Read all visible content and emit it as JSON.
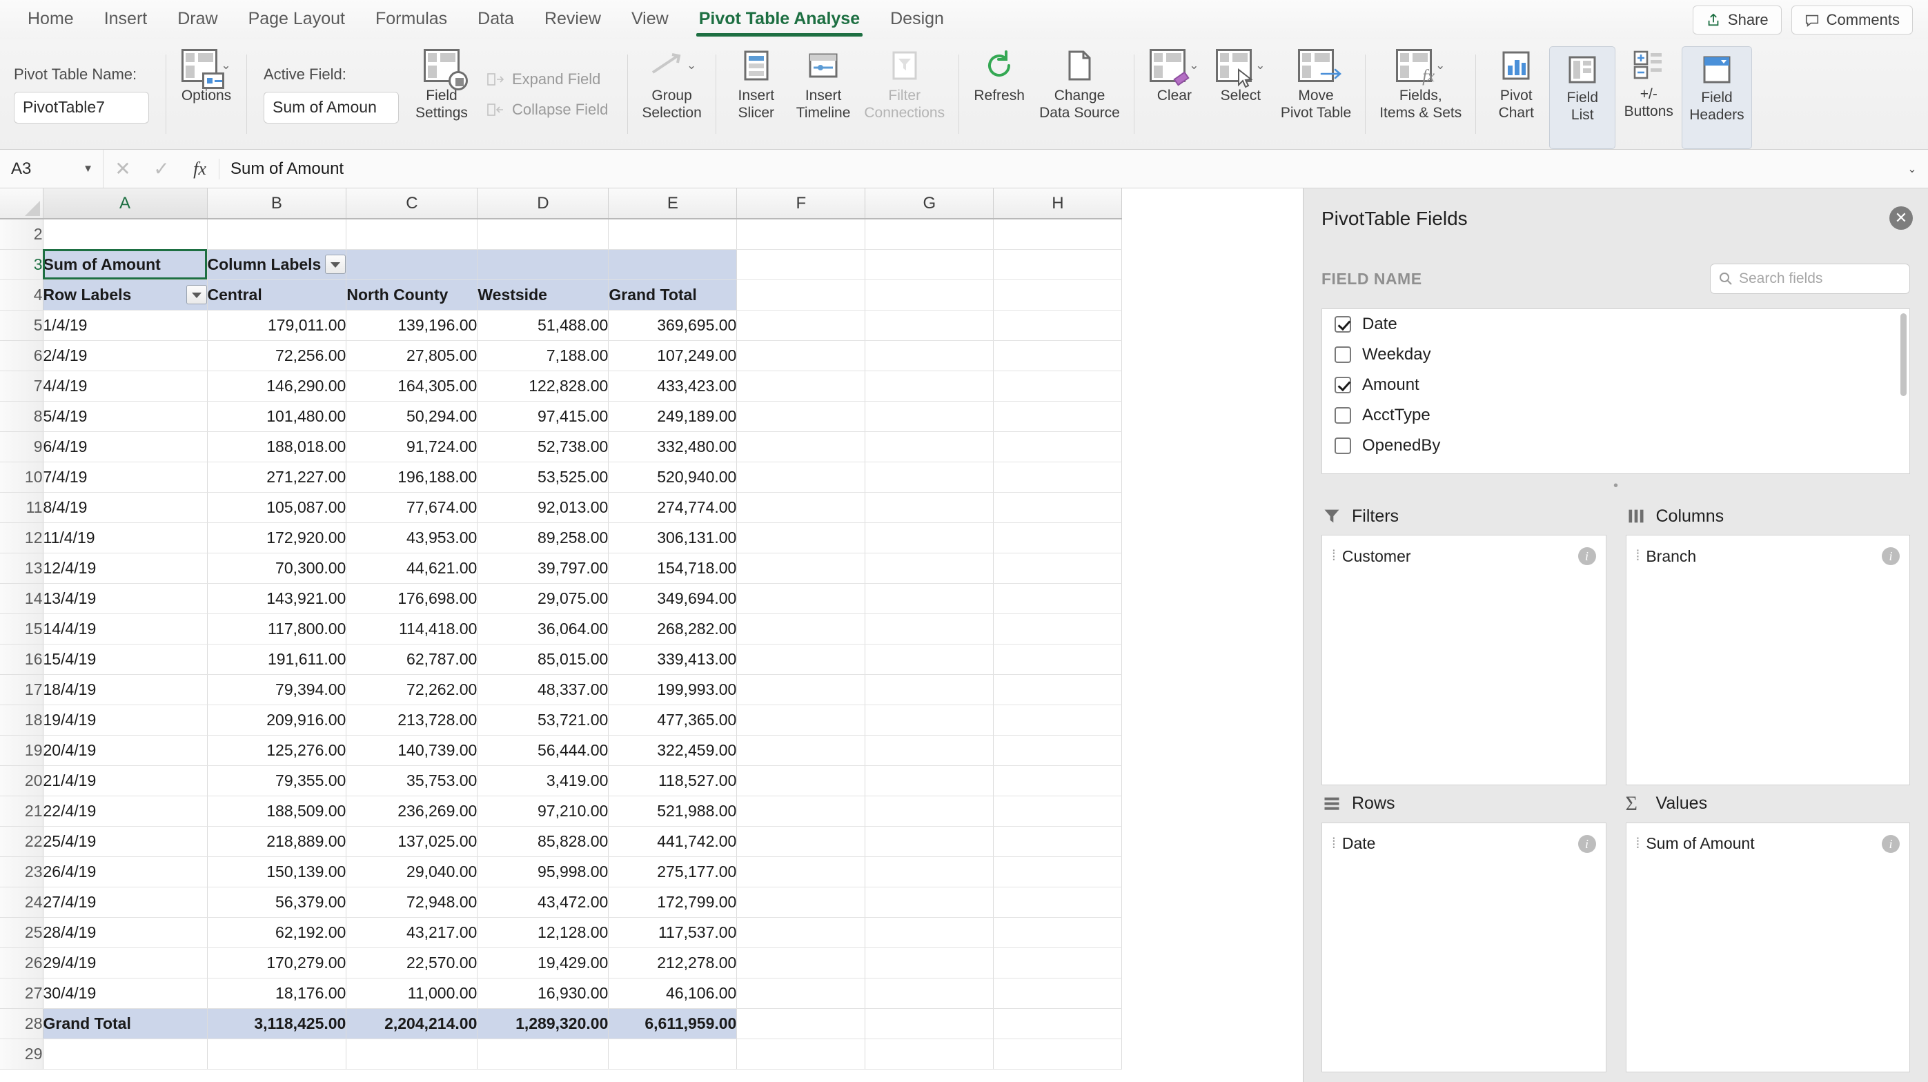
{
  "tabs": [
    {
      "label": "Home",
      "active": false
    },
    {
      "label": "Insert",
      "active": false
    },
    {
      "label": "Draw",
      "active": false
    },
    {
      "label": "Page Layout",
      "active": false
    },
    {
      "label": "Formulas",
      "active": false
    },
    {
      "label": "Data",
      "active": false
    },
    {
      "label": "Review",
      "active": false
    },
    {
      "label": "View",
      "active": false
    },
    {
      "label": "Pivot Table Analyse",
      "active": true
    },
    {
      "label": "Design",
      "active": false
    }
  ],
  "titlebar": {
    "share_label": "Share",
    "comments_label": "Comments"
  },
  "ribbon": {
    "pivot_name_label": "Pivot Table Name:",
    "pivot_name_value": "PivotTable7",
    "options_label": "Options",
    "active_field_label": "Active Field:",
    "active_field_value": "Sum of Amoun",
    "field_settings_label": "Field\nSettings",
    "expand_field_label": "Expand Field",
    "collapse_field_label": "Collapse Field",
    "group_selection_label": "Group\nSelection",
    "insert_slicer_label": "Insert\nSlicer",
    "insert_timeline_label": "Insert\nTimeline",
    "filter_connections_label": "Filter\nConnections",
    "refresh_label": "Refresh",
    "change_data_source_label": "Change\nData Source",
    "clear_label": "Clear",
    "select_label": "Select",
    "move_pivot_table_label": "Move\nPivot Table",
    "fields_items_sets_label": "Fields,\nItems & Sets",
    "pivot_chart_label": "Pivot\nChart",
    "field_list_label": "Field\nList",
    "plus_minus_buttons_label": "+/-\nButtons",
    "field_headers_label": "Field\nHeaders"
  },
  "formula_bar": {
    "name_box": "A3",
    "cancel_icon": "✕",
    "confirm_icon": "✓",
    "fx_label": "fx",
    "value": "Sum of Amount"
  },
  "grid": {
    "column_headers": [
      "A",
      "B",
      "C",
      "D",
      "E",
      "F",
      "G",
      "H"
    ],
    "selected_column": "A",
    "selected_row": 3,
    "row_numbers": [
      2,
      3,
      4,
      5,
      6,
      7,
      8,
      9,
      10,
      11,
      12,
      13,
      14,
      15,
      16,
      17,
      18,
      19,
      20,
      21,
      22,
      23,
      24,
      25,
      26,
      27,
      28,
      29
    ],
    "pivot": {
      "title_cell": "Sum of Amount",
      "column_labels_cell": "Column Labels",
      "row_labels_cell": "Row Labels",
      "headers": [
        "Central",
        "North County",
        "Westside",
        "Grand Total"
      ],
      "grand_total_label": "Grand Total",
      "grand_totals": [
        "3,118,425.00",
        "2,204,214.00",
        "1,289,320.00",
        "6,611,959.00"
      ],
      "rows": [
        {
          "date": "1/4/19",
          "values": [
            "179,011.00",
            "139,196.00",
            "51,488.00",
            "369,695.00"
          ]
        },
        {
          "date": "2/4/19",
          "values": [
            "72,256.00",
            "27,805.00",
            "7,188.00",
            "107,249.00"
          ]
        },
        {
          "date": "4/4/19",
          "values": [
            "146,290.00",
            "164,305.00",
            "122,828.00",
            "433,423.00"
          ]
        },
        {
          "date": "5/4/19",
          "values": [
            "101,480.00",
            "50,294.00",
            "97,415.00",
            "249,189.00"
          ]
        },
        {
          "date": "6/4/19",
          "values": [
            "188,018.00",
            "91,724.00",
            "52,738.00",
            "332,480.00"
          ]
        },
        {
          "date": "7/4/19",
          "values": [
            "271,227.00",
            "196,188.00",
            "53,525.00",
            "520,940.00"
          ]
        },
        {
          "date": "8/4/19",
          "values": [
            "105,087.00",
            "77,674.00",
            "92,013.00",
            "274,774.00"
          ]
        },
        {
          "date": "11/4/19",
          "values": [
            "172,920.00",
            "43,953.00",
            "89,258.00",
            "306,131.00"
          ]
        },
        {
          "date": "12/4/19",
          "values": [
            "70,300.00",
            "44,621.00",
            "39,797.00",
            "154,718.00"
          ]
        },
        {
          "date": "13/4/19",
          "values": [
            "143,921.00",
            "176,698.00",
            "29,075.00",
            "349,694.00"
          ]
        },
        {
          "date": "14/4/19",
          "values": [
            "117,800.00",
            "114,418.00",
            "36,064.00",
            "268,282.00"
          ]
        },
        {
          "date": "15/4/19",
          "values": [
            "191,611.00",
            "62,787.00",
            "85,015.00",
            "339,413.00"
          ]
        },
        {
          "date": "18/4/19",
          "values": [
            "79,394.00",
            "72,262.00",
            "48,337.00",
            "199,993.00"
          ]
        },
        {
          "date": "19/4/19",
          "values": [
            "209,916.00",
            "213,728.00",
            "53,721.00",
            "477,365.00"
          ]
        },
        {
          "date": "20/4/19",
          "values": [
            "125,276.00",
            "140,739.00",
            "56,444.00",
            "322,459.00"
          ]
        },
        {
          "date": "21/4/19",
          "values": [
            "79,355.00",
            "35,753.00",
            "3,419.00",
            "118,527.00"
          ]
        },
        {
          "date": "22/4/19",
          "values": [
            "188,509.00",
            "236,269.00",
            "97,210.00",
            "521,988.00"
          ]
        },
        {
          "date": "25/4/19",
          "values": [
            "218,889.00",
            "137,025.00",
            "85,828.00",
            "441,742.00"
          ]
        },
        {
          "date": "26/4/19",
          "values": [
            "150,139.00",
            "29,040.00",
            "95,998.00",
            "275,177.00"
          ]
        },
        {
          "date": "27/4/19",
          "values": [
            "56,379.00",
            "72,948.00",
            "43,472.00",
            "172,799.00"
          ]
        },
        {
          "date": "28/4/19",
          "values": [
            "62,192.00",
            "43,217.00",
            "12,128.00",
            "117,537.00"
          ]
        },
        {
          "date": "29/4/19",
          "values": [
            "170,279.00",
            "22,570.00",
            "19,429.00",
            "212,278.00"
          ]
        },
        {
          "date": "30/4/19",
          "values": [
            "18,176.00",
            "11,000.00",
            "16,930.00",
            "46,106.00"
          ]
        }
      ]
    }
  },
  "fields_panel": {
    "title": "PivotTable Fields",
    "close_icon": "✕",
    "field_name_header": "FIELD NAME",
    "search_placeholder": "Search fields",
    "fields": [
      {
        "label": "Date",
        "checked": true
      },
      {
        "label": "Weekday",
        "checked": false
      },
      {
        "label": "Amount",
        "checked": true
      },
      {
        "label": "AcctType",
        "checked": false
      },
      {
        "label": "OpenedBy",
        "checked": false
      }
    ],
    "zones": [
      {
        "name": "Filters",
        "items": [
          "Customer"
        ]
      },
      {
        "name": "Columns",
        "items": [
          "Branch"
        ]
      },
      {
        "name": "Rows",
        "items": [
          "Date"
        ]
      },
      {
        "name": "Values",
        "items": [
          "Sum of Amount"
        ]
      }
    ]
  }
}
